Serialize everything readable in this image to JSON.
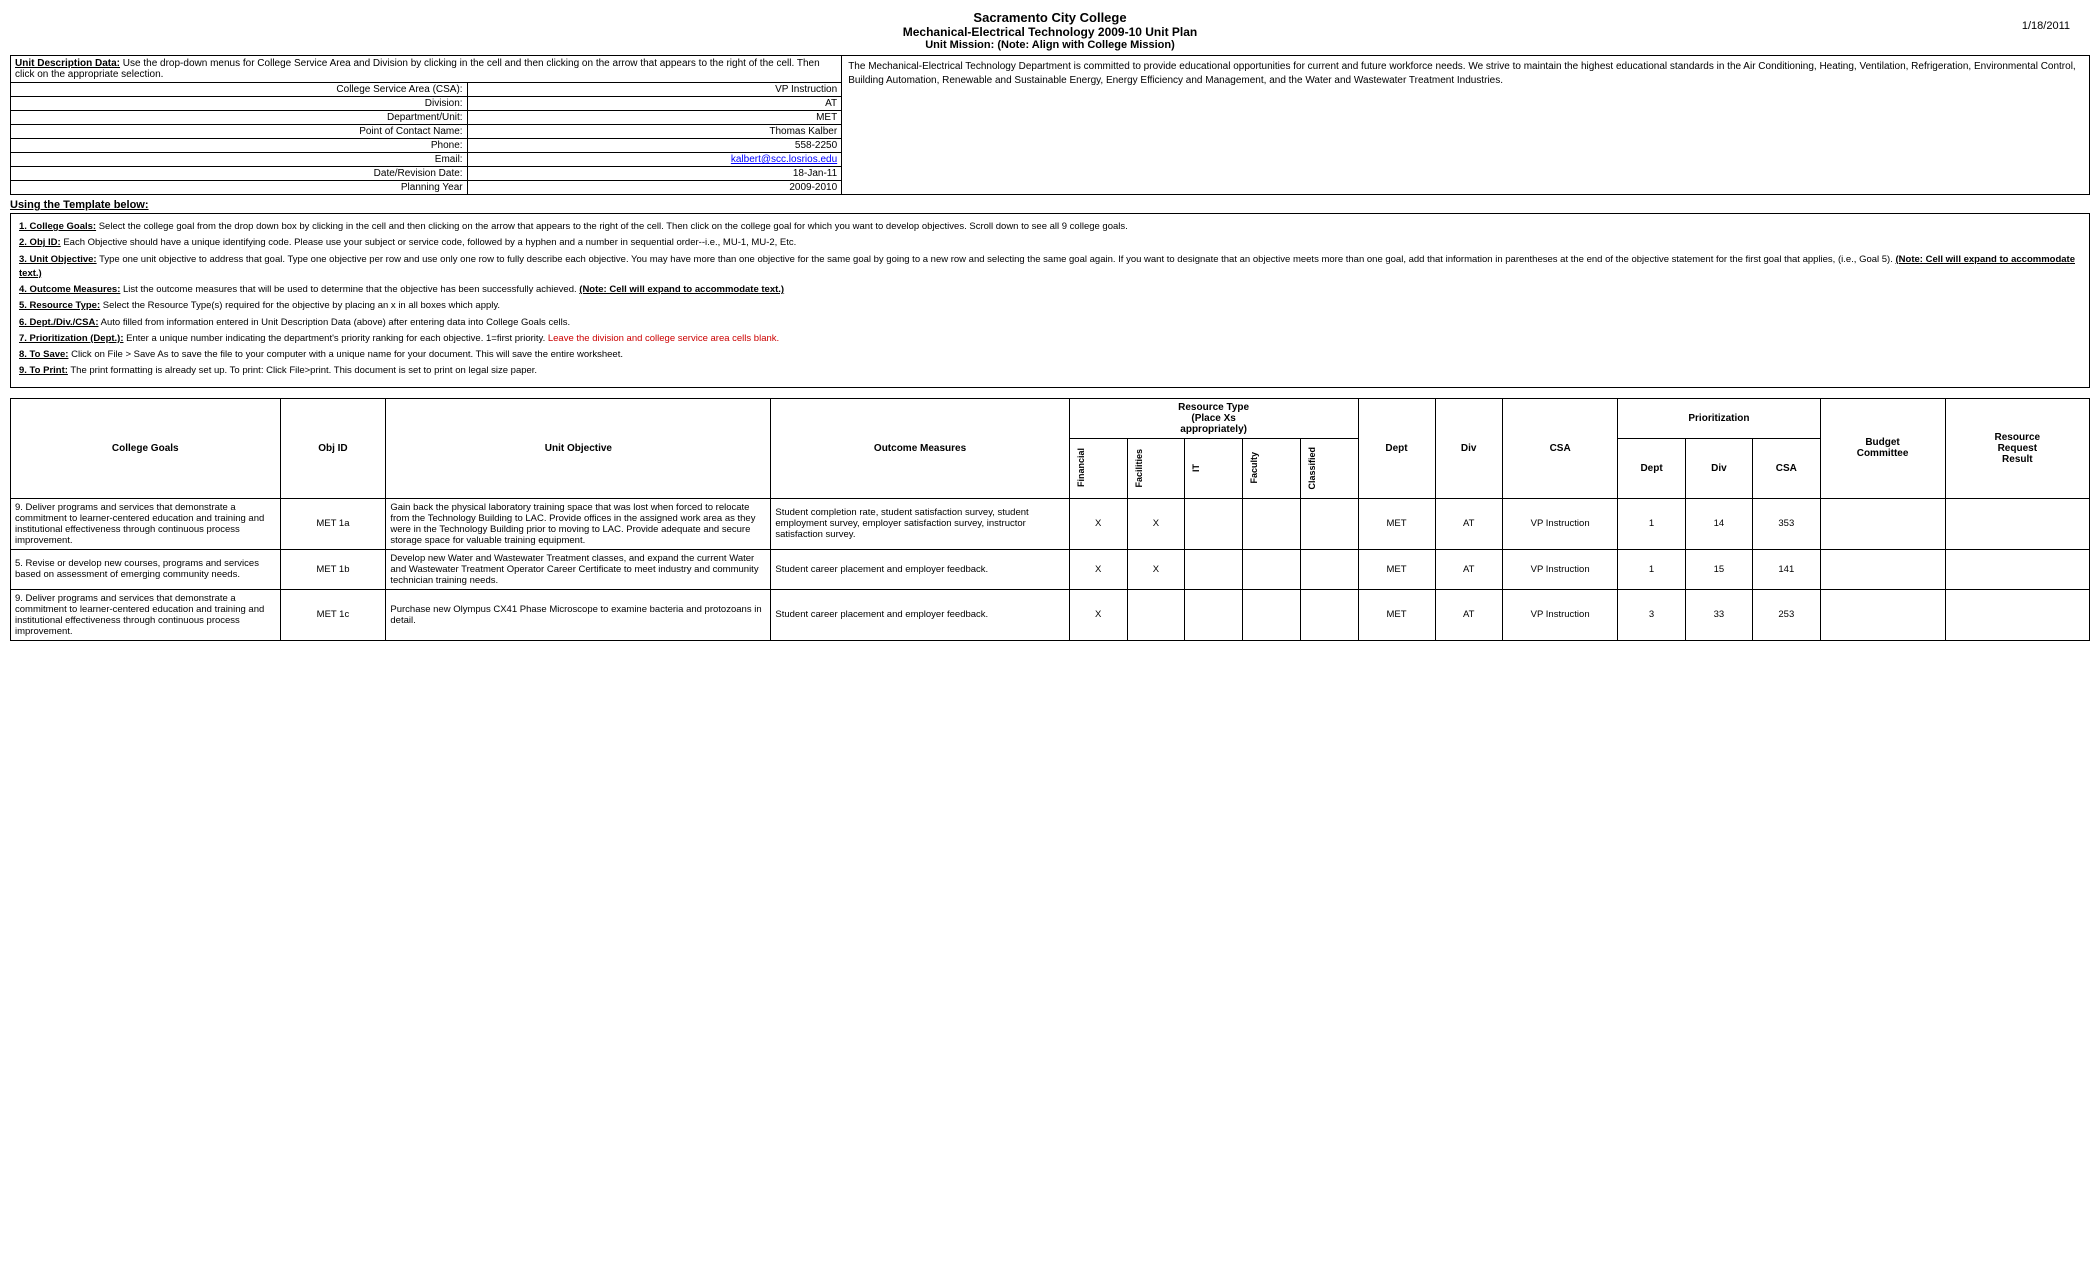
{
  "header": {
    "school": "Sacramento City College",
    "program": "Mechanical-Electrical Technology 2009-10 Unit Plan",
    "mission": "Unit Mission:  (Note:  Align with College Mission)",
    "date": "1/18/2011"
  },
  "unit_description_label": "Unit Description Data:",
  "unit_description_instruction": "Use the drop-down menus for College Service Area and Division by clicking in the cell and then clicking on the arrow that appears to the right of the cell. Then click on the appropriate selection.",
  "mission_text": "The Mechanical-Electrical Technology Department is committed to provide educational opportunities for current and future workforce needs. We strive to maintain the highest educational standards in the Air Conditioning, Heating, Ventilation, Refrigeration, Environmental Control, Building Automation, Renewable and Sustainable Energy, Energy Efficiency and Management, and the Water and Wastewater Treatment Industries.",
  "info_rows": [
    {
      "label": "College Service Area (CSA):",
      "value": "VP Instruction"
    },
    {
      "label": "Division:",
      "value": "AT"
    },
    {
      "label": "Department/Unit:",
      "value": "MET"
    },
    {
      "label": "Point of Contact Name:",
      "value": "Thomas Kalber"
    },
    {
      "label": "Phone:",
      "value": "558-2250"
    },
    {
      "label": "Email:",
      "value": "kalbert@scc.losrios.edu"
    },
    {
      "label": "Date/Revision Date:",
      "value": "18-Jan-11"
    },
    {
      "label": "Planning Year",
      "value": "2009-2010"
    }
  ],
  "template_label": "Using the Template below:",
  "instructions": [
    "1. College Goals: Select the college goal from the drop down box by clicking in the cell and then clicking on the arrow that appears to the right of the cell. Then click on the college goal for which you want to develop objectives. Scroll down to see all 9 college goals.",
    "2. Obj ID:  Each Objective should have a unique identifying code.  Please use your subject or service code, followed by a hyphen and a number in sequential order--i.e., MU-1, MU-2, Etc.",
    "3. Unit Objective: Type one unit objective to address that goal. Type one objective per row and use only one row to fully describe each objective.  You may have more than one objective for the same goal by going to a new row and selecting the same goal again. If you want to designate that an objective meets more than one goal, add that information in parentheses at the end of the objective statement for the first goal that applies, (i.e., Goal 5).  (Note: Cell will expand to accommodate text.)",
    "4. Outcome Measures: List the outcome measures that will be used to determine that the objective has been successfully achieved. (Note: Cell will expand to accommodate text.)",
    "5. Resource Type: Select the Resource Type(s) required for the objective by placing an x in all boxes which apply.",
    "6. Dept./Div./CSA:  Auto filled from information entered in Unit Description Data (above) after entering data into College Goals cells.",
    "7. Prioritization (Dept.): Enter a unique number indicating the department's priority ranking for each objective. 1=first priority. Leave the division and college service area cells blank.",
    "8. To Save:  Click on File > Save As to save the file to your computer with a unique name for your document.  This will save the entire worksheet.",
    "9. To Print:  The print formatting is already set up. To print:  Click File>print. This document is set to print on legal size paper."
  ],
  "table_headers": {
    "college_goals": "College Goals",
    "obj_id": "Obj ID",
    "unit_objective": "Unit Objective",
    "outcome_measures": "Outcome Measures",
    "resource_type": "Resource Type\n(Place Xs\nappropriately)",
    "prioritization": "Prioritization",
    "financial": "Financial",
    "facilities": "Facilities",
    "it": "IT",
    "faculty": "Faculty",
    "classified": "Classified",
    "dept": "Dept",
    "div": "Div",
    "csa": "CSA",
    "pri_dept": "Dept",
    "pri_div": "Div",
    "pri_csa": "CSA",
    "budget_committee": "Budget Committee",
    "resource_request_result": "Resource Request Result"
  },
  "rows": [
    {
      "college_goals": "9. Deliver programs and services that demonstrate a commitment to learner-centered education and training and institutional effectiveness through continuous process improvement.",
      "obj_id": "MET 1a",
      "unit_objective": "Gain back the physical laboratory training space that was lost when forced to relocate from the Technology Building to LAC. Provide offices in the assigned work area as they were in the Technology Building prior to moving to LAC. Provide adequate and secure storage space for valuable training equipment.",
      "outcome_measures": "Student completion rate, student satisfaction survey, student employment survey, employer satisfaction survey, instructor satisfaction survey.",
      "financial": "X",
      "facilities": "X",
      "it": "",
      "faculty": "",
      "classified": "",
      "dept": "MET",
      "div": "AT",
      "csa": "VP Instruction",
      "pri_dept": "1",
      "pri_div": "14",
      "pri_csa": "353",
      "budget_committee": "",
      "resource_request_result": ""
    },
    {
      "college_goals": "5. Revise or develop new courses, programs and services based on assessment of emerging community needs.",
      "obj_id": "MET 1b",
      "unit_objective": "Develop new Water and Wastewater Treatment classes, and expand the current Water and Wastewater Treatment Operator Career Certificate to meet industry and community technician training needs.",
      "outcome_measures": "Student career placement and employer feedback.",
      "financial": "X",
      "facilities": "X",
      "it": "",
      "faculty": "",
      "classified": "",
      "dept": "MET",
      "div": "AT",
      "csa": "VP Instruction",
      "pri_dept": "1",
      "pri_div": "15",
      "pri_csa": "141",
      "budget_committee": "",
      "resource_request_result": ""
    },
    {
      "college_goals": "9. Deliver programs and services that demonstrate a commitment to learner-centered education and training and institutional effectiveness through continuous process improvement.",
      "obj_id": "MET 1c",
      "unit_objective": "Purchase new Olympus CX41 Phase Microscope to examine bacteria and protozoans in detail.",
      "outcome_measures": "Student career placement and employer feedback.",
      "financial": "X",
      "facilities": "",
      "it": "",
      "faculty": "",
      "classified": "",
      "dept": "MET",
      "div": "AT",
      "csa": "VP Instruction",
      "pri_dept": "3",
      "pri_div": "33",
      "pri_csa": "253",
      "budget_committee": "",
      "resource_request_result": ""
    }
  ]
}
